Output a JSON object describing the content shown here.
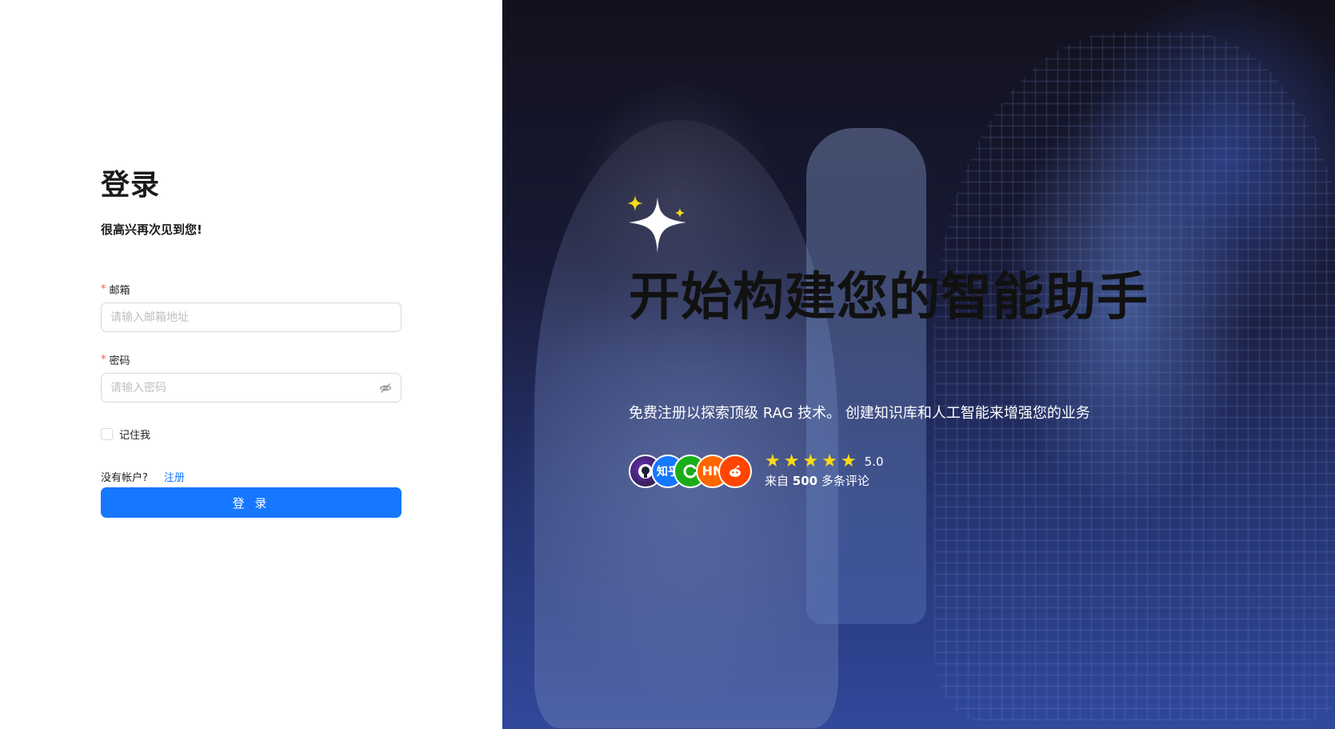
{
  "login": {
    "title": "登录",
    "subtitle": "很高兴再次见到您!",
    "email": {
      "required_mark": "*",
      "label": "邮箱",
      "placeholder": "请输入邮箱地址",
      "value": ""
    },
    "password": {
      "required_mark": "*",
      "label": "密码",
      "placeholder": "请输入密码",
      "value": ""
    },
    "remember_label": "记住我",
    "remember_checked": false,
    "no_account_text": "没有帐户?",
    "register_link": "注册",
    "submit_label": "登 录",
    "accent_color": "#1677ff"
  },
  "hero": {
    "headline": "开始构建您的智能助手",
    "description": "免费注册以探索顶级 RAG 技术。 创建知识库和人工智能来增强您的业务",
    "rating": {
      "stars": 5,
      "score": "5.0",
      "reviews_prefix": "来自",
      "reviews_count": "500",
      "reviews_suffix": "多条评论"
    },
    "avatars": [
      {
        "name": "github-icon",
        "label": ""
      },
      {
        "name": "zhihu-icon",
        "label": "知乎"
      },
      {
        "name": "wechat-icon",
        "label": ""
      },
      {
        "name": "hackernews-icon",
        "label": "HN"
      },
      {
        "name": "reddit-icon",
        "label": ""
      }
    ]
  }
}
